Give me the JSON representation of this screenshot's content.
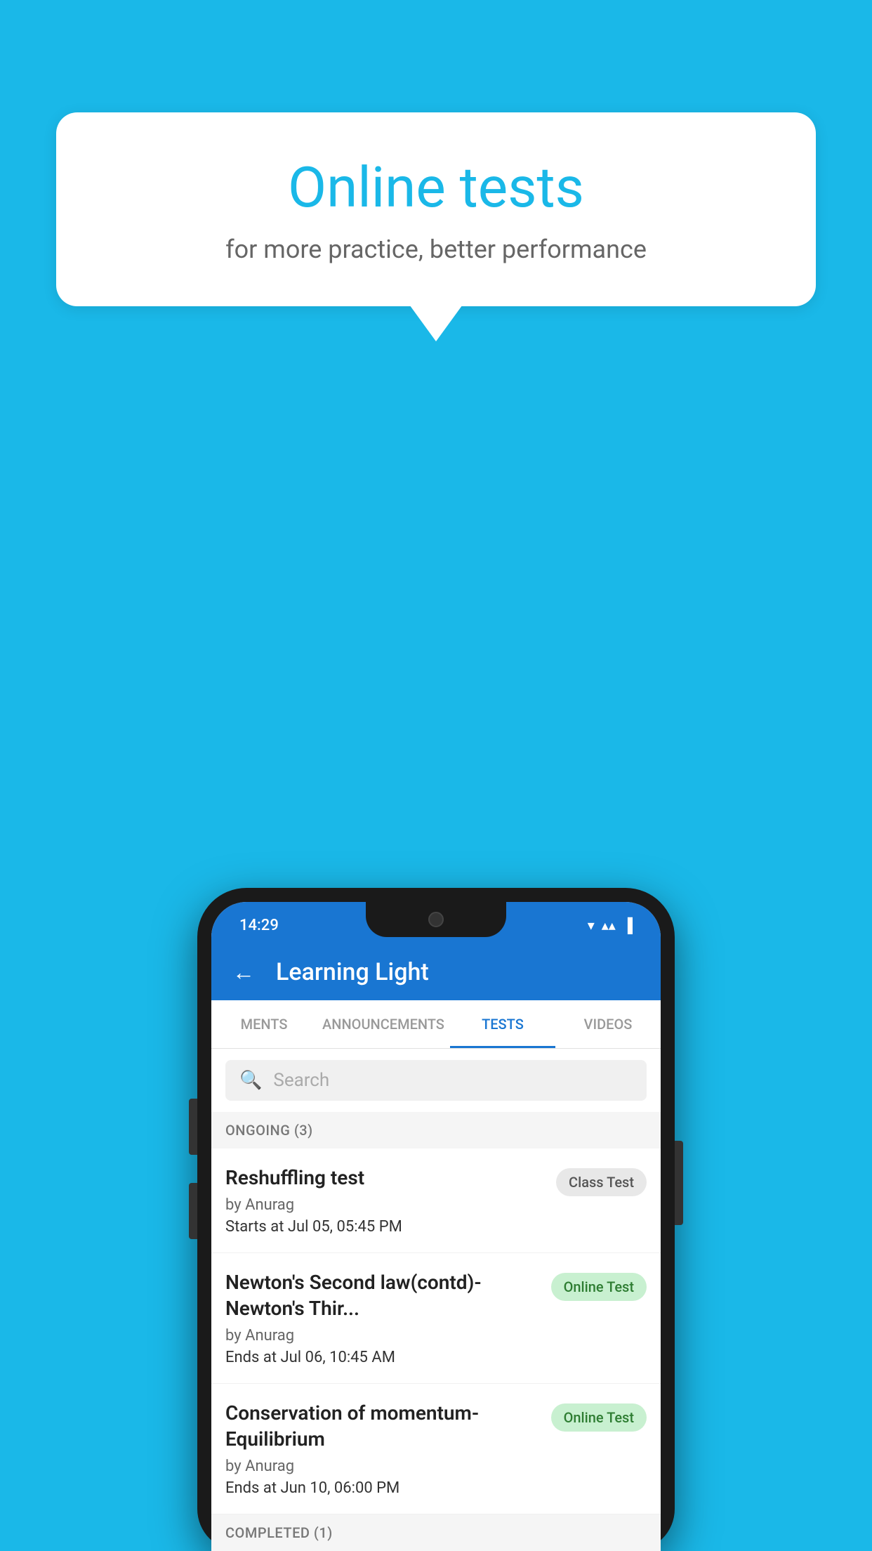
{
  "background": {
    "color": "#1ab8e8"
  },
  "speech_bubble": {
    "title": "Online tests",
    "subtitle": "for more practice, better performance"
  },
  "status_bar": {
    "time": "14:29",
    "wifi_icon": "▼",
    "signal_icon": "▲",
    "battery_icon": "▐"
  },
  "app_bar": {
    "back_label": "←",
    "title": "Learning Light"
  },
  "tabs": [
    {
      "label": "MENTS",
      "active": false
    },
    {
      "label": "ANNOUNCEMENTS",
      "active": false
    },
    {
      "label": "TESTS",
      "active": true
    },
    {
      "label": "VIDEOS",
      "active": false
    }
  ],
  "search": {
    "placeholder": "Search"
  },
  "ongoing_section": {
    "label": "ONGOING (3)"
  },
  "ongoing_tests": [
    {
      "title": "Reshuffling test",
      "author": "by Anurag",
      "time_label": "Starts at",
      "time_value": "Jul 05, 05:45 PM",
      "badge": "Class Test",
      "badge_type": "class"
    },
    {
      "title": "Newton's Second law(contd)-Newton's Thir...",
      "author": "by Anurag",
      "time_label": "Ends at",
      "time_value": "Jul 06, 10:45 AM",
      "badge": "Online Test",
      "badge_type": "online"
    },
    {
      "title": "Conservation of momentum-Equilibrium",
      "author": "by Anurag",
      "time_label": "Ends at",
      "time_value": "Jun 10, 06:00 PM",
      "badge": "Online Test",
      "badge_type": "online"
    }
  ],
  "completed_section": {
    "label": "COMPLETED (1)"
  }
}
